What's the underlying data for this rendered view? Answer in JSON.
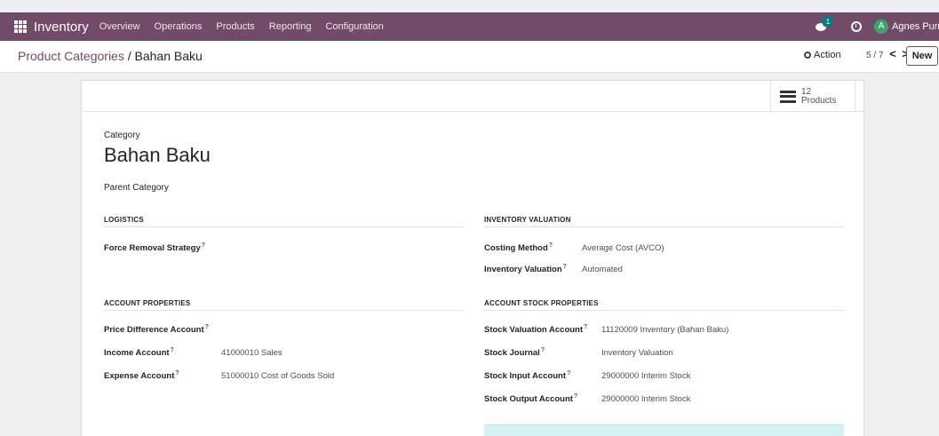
{
  "navbar": {
    "app_name": "Inventory",
    "menu": [
      "Overview",
      "Operations",
      "Products",
      "Reporting",
      "Configuration"
    ],
    "chat_badge": "1",
    "user_initial": "A",
    "user_name": "Agnes Purnamasari"
  },
  "control_panel": {
    "breadcrumb_parent": "Product Categories",
    "breadcrumb_sep": " / ",
    "breadcrumb_current": "Bahan Baku",
    "action_label": "Action",
    "pager": "5 / 7",
    "prev": "<",
    "next": ">",
    "new_label": "New"
  },
  "smart_button": {
    "count": "12",
    "label": "Products"
  },
  "form": {
    "category_label": "Category",
    "name": "Bahan Baku",
    "parent_label": "Parent Category",
    "logistics": {
      "header": "LOGISTICS",
      "force_removal_label": "Force Removal Strategy"
    },
    "inventory_valuation": {
      "header": "INVENTORY VALUATION",
      "costing_method_label": "Costing Method",
      "costing_method_value": "Average Cost (AVCO)",
      "valuation_label": "Inventory Valuation",
      "valuation_value": "Automated"
    },
    "account_properties": {
      "header": "ACCOUNT PROPERTIES",
      "price_diff_label": "Price Difference Account",
      "income_label": "Income Account",
      "income_value": "41000010 Sales",
      "expense_label": "Expense Account",
      "expense_value": "51000010 Cost of Goods Sold"
    },
    "account_stock_properties": {
      "header": "ACCOUNT STOCK PROPERTIES",
      "stock_valuation_label": "Stock Valuation Account",
      "stock_valuation_value": "11120009 Inventory (Bahan Baku)",
      "stock_journal_label": "Stock Journal",
      "stock_journal_value": "Inventory Valuation",
      "stock_input_label": "Stock Input Account",
      "stock_input_value": "29000000 Interim Stock",
      "stock_output_label": "Stock Output Account",
      "stock_output_value": "29000000 Interim Stock"
    },
    "help_mark": "?"
  },
  "colors": {
    "brand": "#714b67",
    "avatar": "#3aa86d",
    "badge": "#017e84"
  }
}
